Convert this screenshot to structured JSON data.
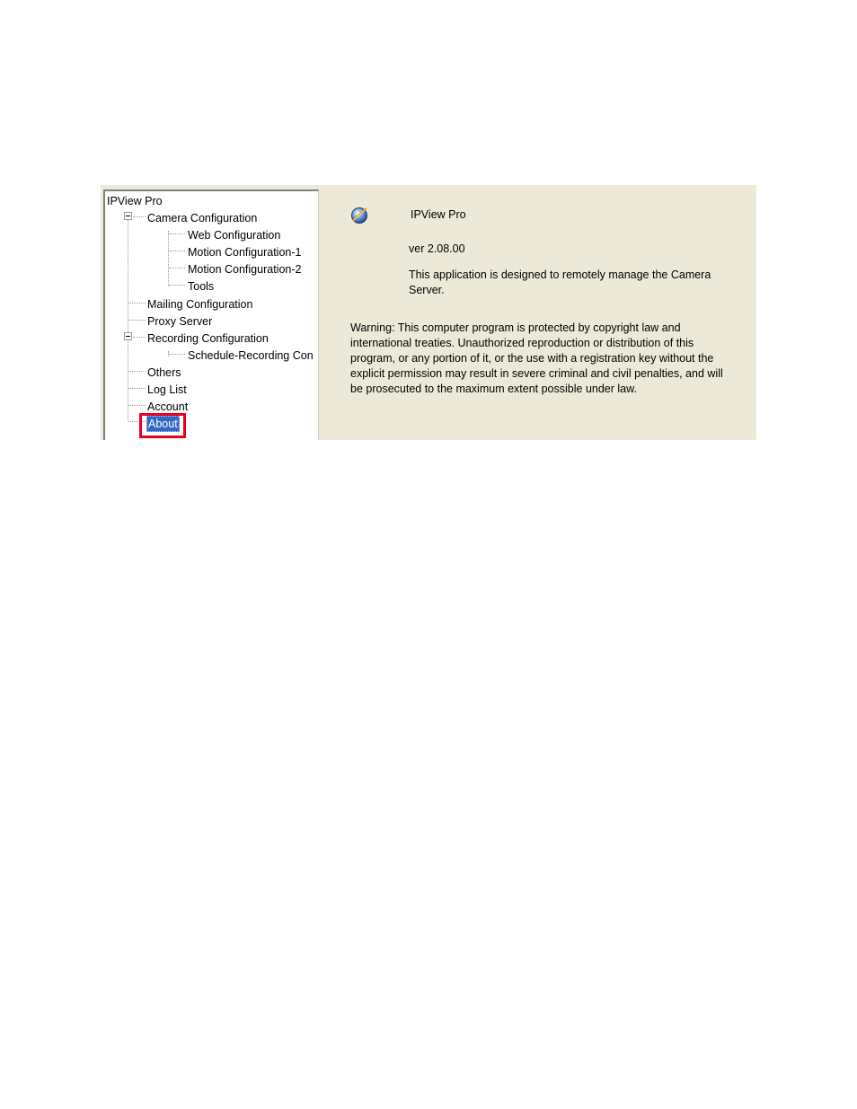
{
  "tree": {
    "root": "IPView Pro",
    "items": [
      {
        "label": "Camera Configuration",
        "level": 1,
        "expanded": true
      },
      {
        "label": "Web Configuration",
        "level": 2
      },
      {
        "label": "Motion Configuration-1",
        "level": 2
      },
      {
        "label": "Motion Configuration-2",
        "level": 2
      },
      {
        "label": "Tools",
        "level": 2
      },
      {
        "label": "Mailing Configuration",
        "level": 1
      },
      {
        "label": "Proxy Server",
        "level": 1
      },
      {
        "label": "Recording Configuration",
        "level": 1,
        "expanded": true
      },
      {
        "label": "Schedule-Recording Con",
        "level": 2
      },
      {
        "label": "Others",
        "level": 1
      },
      {
        "label": "Log List",
        "level": 1
      },
      {
        "label": "Account",
        "level": 1
      },
      {
        "label": "About",
        "level": 1,
        "selected": true
      }
    ]
  },
  "about": {
    "icon": "app-globe-icon",
    "title": "IPView Pro",
    "version": "ver 2.08.00",
    "description_line1": "This application is designed to remotely manage the Camera",
    "description_line2": "Server.",
    "warning_lines": [
      "Warning: This computer program is protected by copyright law and",
      "international treaties. Unauthorized reproduction or distribution of this",
      "program, or any portion of it, or the use with a registration key without the",
      "explicit permission may result in severe criminal and civil penalties, and will",
      "be prosecuted to the maximum extent possible under law."
    ]
  },
  "colors": {
    "panel_bg": "#ece9d8",
    "selection": "#316ac5",
    "highlight_box": "#e8001c"
  }
}
